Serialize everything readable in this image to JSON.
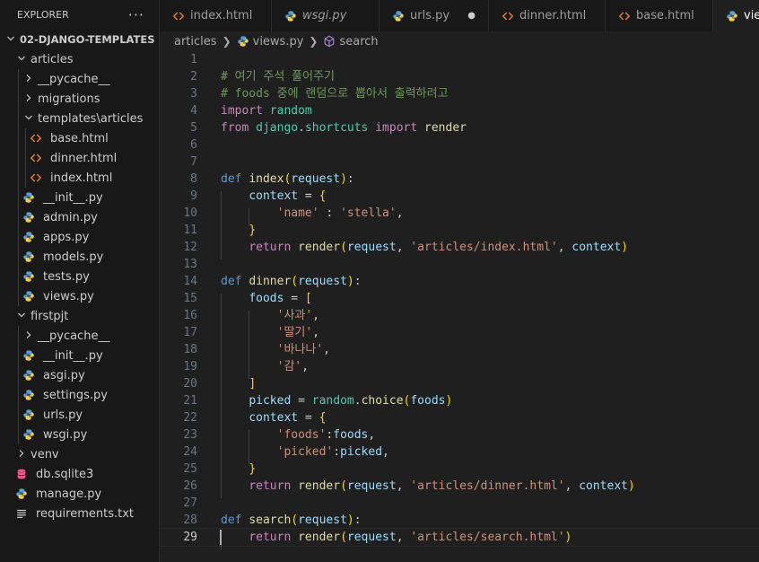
{
  "explorer": {
    "title": "EXPLORER",
    "more_label": "···",
    "items": [
      {
        "label": "02-DJANGO-TEMPLATES",
        "type": "root",
        "depth": 0,
        "expanded": true
      },
      {
        "label": "articles",
        "type": "folder",
        "depth": 1,
        "expanded": true
      },
      {
        "label": "__pycache__",
        "type": "folder",
        "depth": 2,
        "expanded": false
      },
      {
        "label": "migrations",
        "type": "folder",
        "depth": 2,
        "expanded": false
      },
      {
        "label": "templates\\articles",
        "type": "folder",
        "depth": 2,
        "expanded": true
      },
      {
        "label": "base.html",
        "type": "html",
        "depth": 3
      },
      {
        "label": "dinner.html",
        "type": "html",
        "depth": 3
      },
      {
        "label": "index.html",
        "type": "html",
        "depth": 3
      },
      {
        "label": "__init__.py",
        "type": "py",
        "depth": 2
      },
      {
        "label": "admin.py",
        "type": "py",
        "depth": 2
      },
      {
        "label": "apps.py",
        "type": "py",
        "depth": 2
      },
      {
        "label": "models.py",
        "type": "py",
        "depth": 2
      },
      {
        "label": "tests.py",
        "type": "py",
        "depth": 2
      },
      {
        "label": "views.py",
        "type": "py",
        "depth": 2
      },
      {
        "label": "firstpjt",
        "type": "folder",
        "depth": 1,
        "expanded": true
      },
      {
        "label": "__pycache__",
        "type": "folder",
        "depth": 2,
        "expanded": false
      },
      {
        "label": "__init__.py",
        "type": "py",
        "depth": 2
      },
      {
        "label": "asgi.py",
        "type": "py",
        "depth": 2
      },
      {
        "label": "settings.py",
        "type": "py",
        "depth": 2
      },
      {
        "label": "urls.py",
        "type": "py",
        "depth": 2
      },
      {
        "label": "wsgi.py",
        "type": "py",
        "depth": 2
      },
      {
        "label": "venv",
        "type": "folder",
        "depth": 1,
        "expanded": false
      },
      {
        "label": "db.sqlite3",
        "type": "db",
        "depth": 1
      },
      {
        "label": "manage.py",
        "type": "py",
        "depth": 1
      },
      {
        "label": "requirements.txt",
        "type": "txt",
        "depth": 1
      }
    ]
  },
  "tabs": [
    {
      "label": "index.html",
      "icon": "html-file-icon",
      "italic": false,
      "dirty": false,
      "active": false
    },
    {
      "label": "wsgi.py",
      "icon": "python-file-icon",
      "italic": true,
      "dirty": false,
      "active": false
    },
    {
      "label": "urls.py",
      "icon": "python-file-icon",
      "italic": false,
      "dirty": true,
      "active": false
    },
    {
      "label": "dinner.html",
      "icon": "html-file-icon",
      "italic": false,
      "dirty": false,
      "active": false
    },
    {
      "label": "base.html",
      "icon": "html-file-icon",
      "italic": false,
      "dirty": false,
      "active": false
    },
    {
      "label": "views.py",
      "icon": "python-file-icon",
      "italic": false,
      "dirty": false,
      "active": true
    }
  ],
  "breadcrumb": {
    "folder": "articles",
    "file": "views.py",
    "symbol": "search"
  },
  "editor": {
    "current_line": 29,
    "lines": [
      {
        "n": "1",
        "tokens": []
      },
      {
        "n": "2",
        "tokens": [
          {
            "c": "cm",
            "t": "# 여기 주석 풀어주기"
          }
        ]
      },
      {
        "n": "3",
        "tokens": [
          {
            "c": "cm",
            "t": "# foods 중에 랜덤으로 뽑아서 출력하려고"
          }
        ]
      },
      {
        "n": "4",
        "tokens": [
          {
            "c": "kw",
            "t": "import"
          },
          {
            "c": "op",
            "t": " "
          },
          {
            "c": "mod",
            "t": "random"
          }
        ]
      },
      {
        "n": "5",
        "tokens": [
          {
            "c": "kw",
            "t": "from"
          },
          {
            "c": "op",
            "t": " "
          },
          {
            "c": "mod",
            "t": "django"
          },
          {
            "c": "op",
            "t": "."
          },
          {
            "c": "mod",
            "t": "shortcuts"
          },
          {
            "c": "op",
            "t": " "
          },
          {
            "c": "kw",
            "t": "import"
          },
          {
            "c": "op",
            "t": " "
          },
          {
            "c": "fn",
            "t": "render"
          }
        ]
      },
      {
        "n": "6",
        "tokens": []
      },
      {
        "n": "7",
        "tokens": []
      },
      {
        "n": "8",
        "tokens": [
          {
            "c": "kwd",
            "t": "def"
          },
          {
            "c": "op",
            "t": " "
          },
          {
            "c": "fn",
            "t": "index"
          },
          {
            "c": "b1",
            "t": "("
          },
          {
            "c": "vr",
            "t": "request"
          },
          {
            "c": "b1",
            "t": ")"
          },
          {
            "c": "op",
            "t": ":"
          }
        ]
      },
      {
        "n": "9",
        "tokens": [
          {
            "c": "op",
            "t": "    "
          },
          {
            "c": "vr",
            "t": "context"
          },
          {
            "c": "op",
            "t": " = "
          },
          {
            "c": "b1",
            "t": "{"
          }
        ]
      },
      {
        "n": "10",
        "tokens": [
          {
            "c": "op",
            "t": "        "
          },
          {
            "c": "st",
            "t": "'name'"
          },
          {
            "c": "op",
            "t": " : "
          },
          {
            "c": "st",
            "t": "'stella'"
          },
          {
            "c": "op",
            "t": ","
          }
        ]
      },
      {
        "n": "11",
        "tokens": [
          {
            "c": "op",
            "t": "    "
          },
          {
            "c": "b1",
            "t": "}"
          }
        ]
      },
      {
        "n": "12",
        "tokens": [
          {
            "c": "op",
            "t": "    "
          },
          {
            "c": "kw",
            "t": "return"
          },
          {
            "c": "op",
            "t": " "
          },
          {
            "c": "fn",
            "t": "render"
          },
          {
            "c": "b1",
            "t": "("
          },
          {
            "c": "vr",
            "t": "request"
          },
          {
            "c": "op",
            "t": ", "
          },
          {
            "c": "st",
            "t": "'articles/index.html'"
          },
          {
            "c": "op",
            "t": ", "
          },
          {
            "c": "vr",
            "t": "context"
          },
          {
            "c": "b1",
            "t": ")"
          }
        ]
      },
      {
        "n": "13",
        "tokens": []
      },
      {
        "n": "14",
        "tokens": [
          {
            "c": "kwd",
            "t": "def"
          },
          {
            "c": "op",
            "t": " "
          },
          {
            "c": "fn",
            "t": "dinner"
          },
          {
            "c": "b1",
            "t": "("
          },
          {
            "c": "vr",
            "t": "request"
          },
          {
            "c": "b1",
            "t": ")"
          },
          {
            "c": "op",
            "t": ":"
          }
        ]
      },
      {
        "n": "15",
        "tokens": [
          {
            "c": "op",
            "t": "    "
          },
          {
            "c": "vr",
            "t": "foods"
          },
          {
            "c": "op",
            "t": " = "
          },
          {
            "c": "b1",
            "t": "["
          }
        ]
      },
      {
        "n": "16",
        "tokens": [
          {
            "c": "op",
            "t": "        "
          },
          {
            "c": "st",
            "t": "'사과'"
          },
          {
            "c": "op",
            "t": ","
          }
        ]
      },
      {
        "n": "17",
        "tokens": [
          {
            "c": "op",
            "t": "        "
          },
          {
            "c": "st",
            "t": "'딸기'"
          },
          {
            "c": "op",
            "t": ","
          }
        ]
      },
      {
        "n": "18",
        "tokens": [
          {
            "c": "op",
            "t": "        "
          },
          {
            "c": "st",
            "t": "'바나나'"
          },
          {
            "c": "op",
            "t": ","
          }
        ]
      },
      {
        "n": "19",
        "tokens": [
          {
            "c": "op",
            "t": "        "
          },
          {
            "c": "st",
            "t": "'감'"
          },
          {
            "c": "op",
            "t": ","
          }
        ]
      },
      {
        "n": "20",
        "tokens": [
          {
            "c": "op",
            "t": "    "
          },
          {
            "c": "b1",
            "t": "]"
          }
        ]
      },
      {
        "n": "21",
        "tokens": [
          {
            "c": "op",
            "t": "    "
          },
          {
            "c": "vr",
            "t": "picked"
          },
          {
            "c": "op",
            "t": " = "
          },
          {
            "c": "mod",
            "t": "random"
          },
          {
            "c": "op",
            "t": "."
          },
          {
            "c": "fn",
            "t": "choice"
          },
          {
            "c": "b1",
            "t": "("
          },
          {
            "c": "vr",
            "t": "foods"
          },
          {
            "c": "b1",
            "t": ")"
          }
        ]
      },
      {
        "n": "22",
        "tokens": [
          {
            "c": "op",
            "t": "    "
          },
          {
            "c": "vr",
            "t": "context"
          },
          {
            "c": "op",
            "t": " = "
          },
          {
            "c": "b1",
            "t": "{"
          }
        ]
      },
      {
        "n": "23",
        "tokens": [
          {
            "c": "op",
            "t": "        "
          },
          {
            "c": "st",
            "t": "'foods'"
          },
          {
            "c": "op",
            "t": ":"
          },
          {
            "c": "vr",
            "t": "foods"
          },
          {
            "c": "op",
            "t": ","
          }
        ]
      },
      {
        "n": "24",
        "tokens": [
          {
            "c": "op",
            "t": "        "
          },
          {
            "c": "st",
            "t": "'picked'"
          },
          {
            "c": "op",
            "t": ":"
          },
          {
            "c": "vr",
            "t": "picked"
          },
          {
            "c": "op",
            "t": ","
          }
        ]
      },
      {
        "n": "25",
        "tokens": [
          {
            "c": "op",
            "t": "    "
          },
          {
            "c": "b1",
            "t": "}"
          }
        ]
      },
      {
        "n": "26",
        "tokens": [
          {
            "c": "op",
            "t": "    "
          },
          {
            "c": "kw",
            "t": "return"
          },
          {
            "c": "op",
            "t": " "
          },
          {
            "c": "fn",
            "t": "render"
          },
          {
            "c": "b1",
            "t": "("
          },
          {
            "c": "vr",
            "t": "request"
          },
          {
            "c": "op",
            "t": ", "
          },
          {
            "c": "st",
            "t": "'articles/dinner.html'"
          },
          {
            "c": "op",
            "t": ", "
          },
          {
            "c": "vr",
            "t": "context"
          },
          {
            "c": "b1",
            "t": ")"
          }
        ]
      },
      {
        "n": "27",
        "tokens": []
      },
      {
        "n": "28",
        "tokens": [
          {
            "c": "kwd",
            "t": "def"
          },
          {
            "c": "op",
            "t": " "
          },
          {
            "c": "fn",
            "t": "search"
          },
          {
            "c": "b1",
            "t": "("
          },
          {
            "c": "vr",
            "t": "request"
          },
          {
            "c": "b1",
            "t": ")"
          },
          {
            "c": "op",
            "t": ":"
          }
        ]
      },
      {
        "n": "29",
        "tokens": [
          {
            "c": "op",
            "t": "    "
          },
          {
            "c": "kw",
            "t": "return"
          },
          {
            "c": "op",
            "t": " "
          },
          {
            "c": "fn",
            "t": "render"
          },
          {
            "c": "b1",
            "t": "("
          },
          {
            "c": "vr",
            "t": "request"
          },
          {
            "c": "op",
            "t": ", "
          },
          {
            "c": "st",
            "t": "'articles/search.html'"
          },
          {
            "c": "b1",
            "t": ")"
          }
        ]
      }
    ]
  }
}
